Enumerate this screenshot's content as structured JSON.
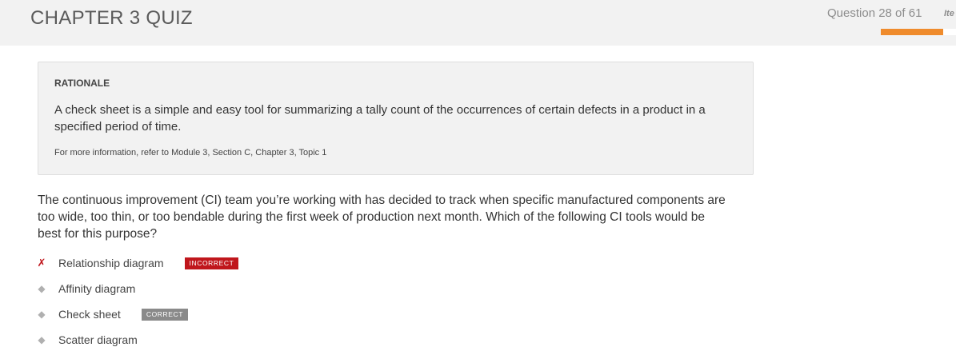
{
  "header": {
    "title": "CHAPTER 3 QUIZ",
    "progress_text": "Question 28 of 61",
    "items_label": "Ite",
    "progress_fraction": 0.46
  },
  "rationale": {
    "heading": "RATIONALE",
    "text": "A check sheet is a simple and easy tool for summarizing a tally count of the occurrences of certain defects in a product in a specified period of time.",
    "reference": "For more information, refer to Module 3, Section C, Chapter 3, Topic 1"
  },
  "question": {
    "text": "The continuous improvement (CI) team you’re working with has decided to track when specific manufactured components are too wide, too thin, or too bendable during the first week of production next month. Which of the following CI tools would be best for this purpose?"
  },
  "options": [
    {
      "marker": "✗",
      "label": "Relationship diagram",
      "badge": "INCORRECT"
    },
    {
      "marker": "◆",
      "label": "Affinity diagram"
    },
    {
      "marker": "◆",
      "label": "Check sheet",
      "badge": "CORRECT"
    },
    {
      "marker": "◆",
      "label": "Scatter diagram"
    }
  ],
  "colors": {
    "accent": "#ef8b2c",
    "incorrect": "#c0161c",
    "correct_badge": "#8a8a8a"
  }
}
